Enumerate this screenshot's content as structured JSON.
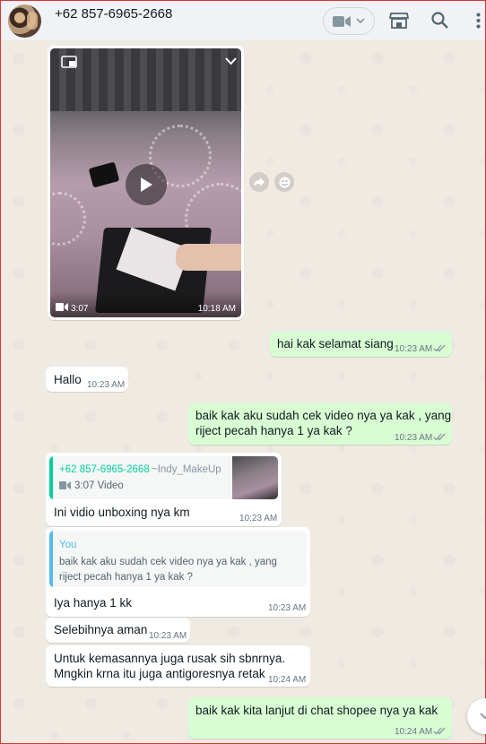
{
  "header": {
    "contact_name": "+62 857-6965-2668",
    "icons": [
      "avatar",
      "video-call-icon",
      "chevron-down-icon",
      "shop-icon",
      "search-icon",
      "menu-icon"
    ]
  },
  "messages": {
    "video": {
      "duration": "3:07",
      "time": "10:18 AM"
    },
    "m1": {
      "text": "hai kak selamat siang",
      "time": "10:23 AM"
    },
    "m2": {
      "text": "Hallo",
      "time": "10:23 AM"
    },
    "m3": {
      "text_line1": "baik kak aku sudah cek video nya ya kak , yang",
      "text_line2": "riject pecah hanya 1 ya kak ?",
      "time": "10:23 AM"
    },
    "m4": {
      "quote_author": "+62 857-6965-2668",
      "quote_alias": "~Indy_MakeUp",
      "quote_media": "3:07 Video",
      "text": "Ini vidio unboxing nya km",
      "time": "10:23 AM"
    },
    "m5": {
      "quote_author": "You",
      "quote_line1": "baik kak aku sudah cek video nya ya kak , yang",
      "quote_line2": "riject pecah hanya 1 ya kak ?",
      "text": "Iya hanya 1 kk",
      "time": "10:23 AM"
    },
    "m6": {
      "text": "Selebihnya aman",
      "time": "10:23 AM"
    },
    "m7": {
      "text_line1": "Untuk kemasannya juga rusak sih sbnrnya.",
      "text_line2": "Mngkin krna itu juga antigoresnya retak",
      "time": "10:24 AM"
    },
    "m8": {
      "text": "baik kak kita lanjut di chat shopee nya ya kak",
      "time": "10:24 AM"
    }
  },
  "colors": {
    "accent_green": "#25d366",
    "quote_you": "#53bdeb",
    "quote_contact": "#06cf9c",
    "read_ticks": "#8696a0"
  }
}
